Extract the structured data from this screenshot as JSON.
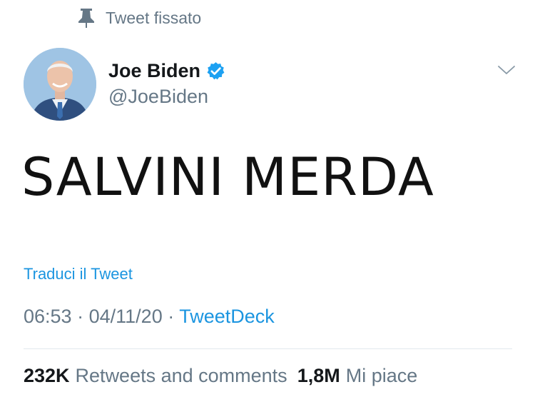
{
  "pinned": {
    "label": "Tweet fissato",
    "icon": "pin-icon"
  },
  "author": {
    "name": "Joe Biden",
    "handle": "@JoeBiden",
    "verified_icon": "verified-badge-icon",
    "avatar_icon": "avatar-photo"
  },
  "menu": {
    "icon": "chevron-down-icon"
  },
  "tweet": {
    "text": "SALVINI MERDA"
  },
  "translate": {
    "label": "Traduci il Tweet"
  },
  "meta": {
    "time": "06:53",
    "date": "04/11/20",
    "source": "TweetDeck",
    "separator": "·"
  },
  "stats": {
    "retweets_count": "232K",
    "retweets_label": "Retweets and comments",
    "likes_count": "1,8M",
    "likes_label": "Mi piace"
  },
  "colors": {
    "link": "#1b95e0",
    "secondary_text": "#657786",
    "primary_text": "#14171a",
    "verified": "#1da1f2"
  }
}
